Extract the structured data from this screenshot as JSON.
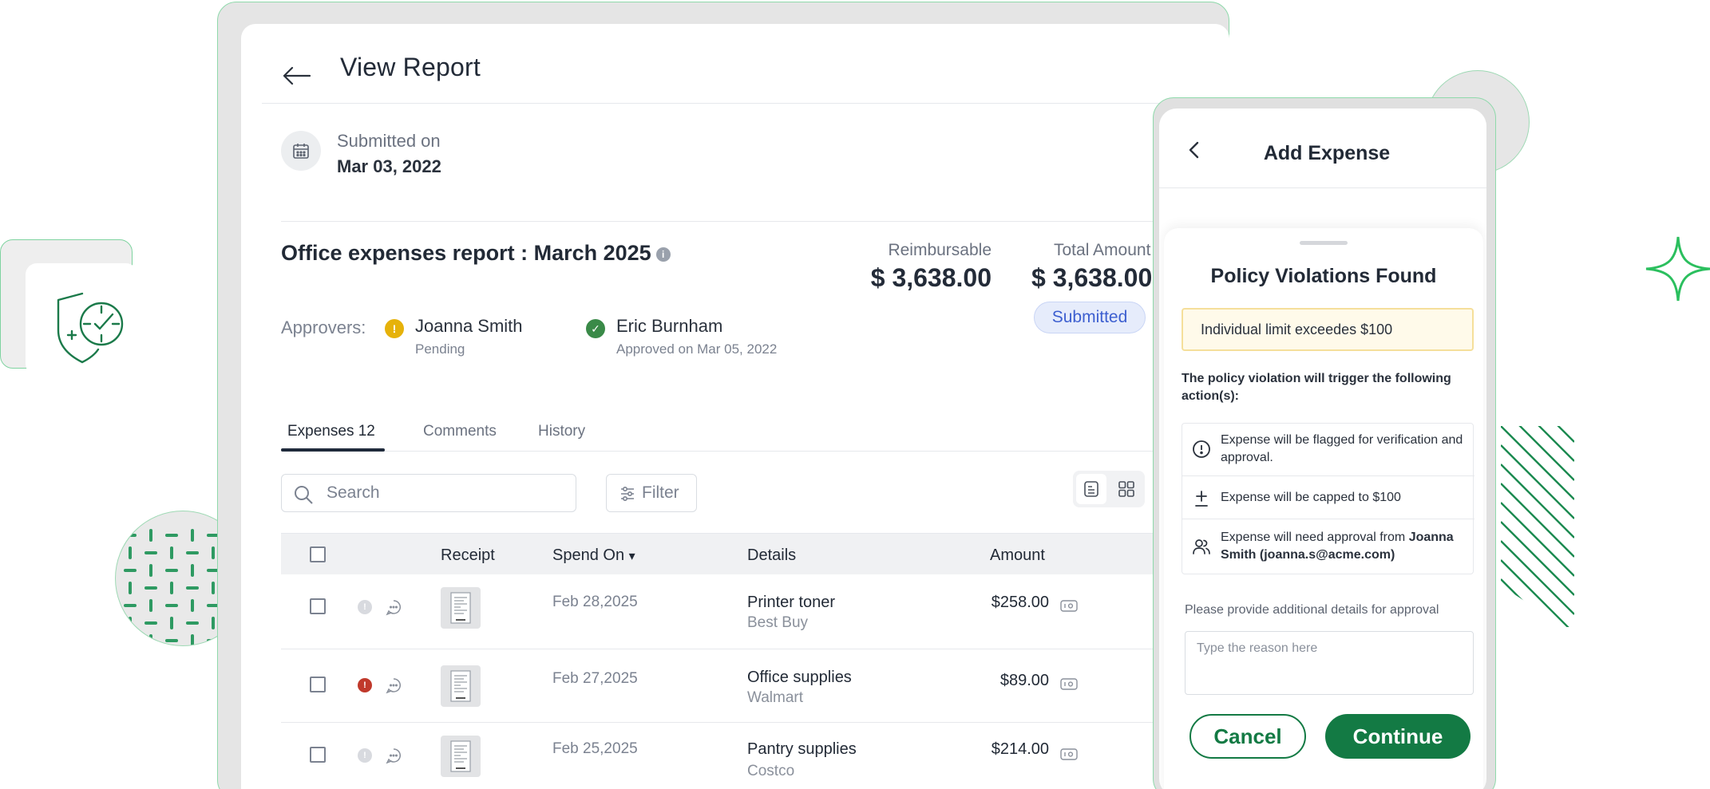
{
  "report": {
    "title": "View Report",
    "submitted_label": "Submitted on",
    "submitted_date": "Mar 03, 2022",
    "name": "Office expenses report : March 2025",
    "info_glyph": "i",
    "approvers_label": "Approvers:",
    "approvers": [
      {
        "name": "Joanna Smith",
        "status": "Pending",
        "color": "#e6b20a",
        "glyph": "!"
      },
      {
        "name": "Eric Burnham",
        "status": "Approved on Mar 05, 2022",
        "color": "#3a8a48",
        "glyph": "✓"
      }
    ],
    "reimbursable_label": "Reimbursable",
    "reimbursable_value": "$ 3,638.00",
    "total_label": "Total Amount",
    "total_value": "$ 3,638.00",
    "status": "Submitted"
  },
  "tabs": [
    {
      "label": "Expenses 12",
      "active": true
    },
    {
      "label": "Comments",
      "active": false
    },
    {
      "label": "History",
      "active": false
    }
  ],
  "toolbar": {
    "search_placeholder": "Search",
    "filter_label": "Filter"
  },
  "table": {
    "columns": [
      "Receipt",
      "Spend On",
      "Details",
      "Amount"
    ],
    "sort_glyph": "▾",
    "rows": [
      {
        "date": "Feb 28,2025",
        "title": "Printer toner",
        "vendor": "Best Buy",
        "amount": "$258.00",
        "flag": "#d8dadf",
        "flag_glyph": "!"
      },
      {
        "date": "Feb 27,2025",
        "title": "Office supplies",
        "vendor": "Walmart",
        "amount": "$89.00",
        "flag": "#c0392b",
        "flag_glyph": "!"
      },
      {
        "date": "Feb 25,2025",
        "title": "Pantry supplies",
        "vendor": "Costco",
        "amount": "$214.00",
        "flag": "#d8dadf",
        "flag_glyph": "!"
      }
    ]
  },
  "modal": {
    "header_title": "Add Expense",
    "sheet_title": "Policy Violations Found",
    "warning": "Individual limit exceedes $100",
    "subtitle": "The policy violation will trigger the following action(s):",
    "actions": [
      {
        "icon": "alert-circle-icon",
        "text": "Expense will be flagged for verification and approval."
      },
      {
        "icon": "cap-limit-icon",
        "text": "Expense will be capped to $100"
      },
      {
        "icon": "approver-users-icon",
        "text_prefix": "Expense will need approval from ",
        "text_bold": "Joanna Smith (joanna.s@acme.com)"
      }
    ],
    "details_label": "Please provide additional details for approval",
    "reason_placeholder": "Type the reason here",
    "cancel_label": "Cancel",
    "continue_label": "Continue"
  },
  "colors": {
    "brand_green": "#137a44",
    "submitted_blue": "#3d5fd0",
    "warning_bg": "#fffaea"
  }
}
